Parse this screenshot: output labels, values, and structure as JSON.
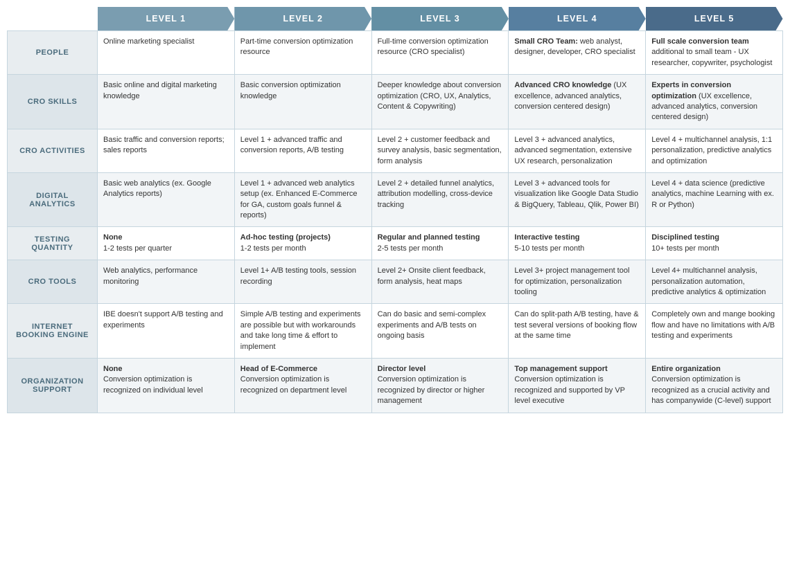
{
  "headers": {
    "corner": "",
    "levels": [
      {
        "id": "l1",
        "label": "LEVEL 1"
      },
      {
        "id": "l2",
        "label": "LEVEL 2"
      },
      {
        "id": "l3",
        "label": "LEVEL 3"
      },
      {
        "id": "l4",
        "label": "LEVEL 4"
      },
      {
        "id": "l5",
        "label": "LEVEL 5"
      }
    ]
  },
  "rows": [
    {
      "rowHeader": "PEOPLE",
      "cells": [
        "Online marketing specialist",
        "Part-time conversion optimization resource",
        "Full-time conversion optimization resource (CRO specialist)",
        "<b>Small CRO Team:</b> web analyst, designer, developer, CRO specialist",
        "<b>Full scale conversion team</b> additional to small team - UX researcher, copywriter, psychologist"
      ]
    },
    {
      "rowHeader": "CRO SKILLS",
      "cells": [
        "Basic online and digital marketing knowledge",
        "Basic conversion optimization knowledge",
        "Deeper knowledge about conversion optimization (CRO, UX, Analytics, Content & Copywriting)",
        "<b>Advanced CRO knowledge</b> (UX excellence, advanced analytics, conversion centered design)",
        "<b>Experts in conversion optimization</b> (UX excellence, advanced analytics, conversion centered design)"
      ]
    },
    {
      "rowHeader": "CRO ACTIVITIES",
      "cells": [
        "Basic traffic and conversion reports; sales reports",
        "Level 1 + advanced traffic and conversion reports, A/B testing",
        "Level 2 + customer feedback and survey analysis, basic segmentation, form analysis",
        "Level 3 + advanced analytics, advanced segmentation, extensive UX research, personalization",
        "Level 4 + multichannel analysis, 1:1 personalization, predictive analytics and optimization"
      ]
    },
    {
      "rowHeader": "DIGITAL\nANALYTICS",
      "cells": [
        "Basic web analytics (ex. Google Analytics reports)",
        "Level 1 + advanced web analytics setup (ex. Enhanced E-Commerce for GA, custom goals funnel & reports)",
        "Level 2 + detailed funnel analytics, attribution modelling, cross-device tracking",
        "Level 3 + advanced tools for visualization like Google Data Studio & BigQuery, Tableau, Qlik, Power BI)",
        "Level 4 + data science (predictive analytics, machine Learning with ex. R or Python)"
      ]
    },
    {
      "rowHeader": "TESTING\nQUANTITY",
      "cells": [
        "<b>None</b>\n1-2 tests per quarter",
        "<b>Ad-hoc testing (projects)</b>\n1-2 tests per month",
        "<b>Regular and planned testing</b>\n2-5 tests per month",
        "<b>Interactive testing</b>\n5-10 tests per month",
        "<b>Disciplined testing</b>\n10+ tests per month"
      ]
    },
    {
      "rowHeader": "CRO TOOLS",
      "cells": [
        "Web analytics, performance monitoring",
        "Level 1+ A/B testing tools, session recording",
        "Level 2+ Onsite client feedback, form analysis, heat maps",
        "Level 3+ project management tool for optimization, personalization tooling",
        "Level 4+ multichannel analysis, personalization automation, predictive analytics & optimization"
      ]
    },
    {
      "rowHeader": "INTERNET\nBOOKING ENGINE",
      "cells": [
        "IBE doesn't support A/B testing and experiments",
        "Simple A/B testing and experiments are possible but with workarounds and take long time & effort to implement",
        "Can do basic and semi-complex experiments and A/B tests on ongoing basis",
        "Can do split-path A/B testing, have & test several versions of booking flow at the same time",
        "Completely own and mange booking flow and have no limitations with A/B testing and experiments"
      ]
    },
    {
      "rowHeader": "ORGANIZATION\nSUPPORT",
      "cells": [
        "<b>None</b>\nConversion optimization is recognized on individual level",
        "<b>Head of E-Commerce</b>\nConversion optimization is recognized on department level",
        "<b>Director level</b>\nConversion optimization is recognized by director or higher management",
        "<b>Top management support</b>\nConversion optimization is recognized and supported by VP level executive",
        "<b>Entire organization</b>\nConversion optimization is recognized as a crucial activity and has companywide (C-level) support"
      ]
    }
  ]
}
